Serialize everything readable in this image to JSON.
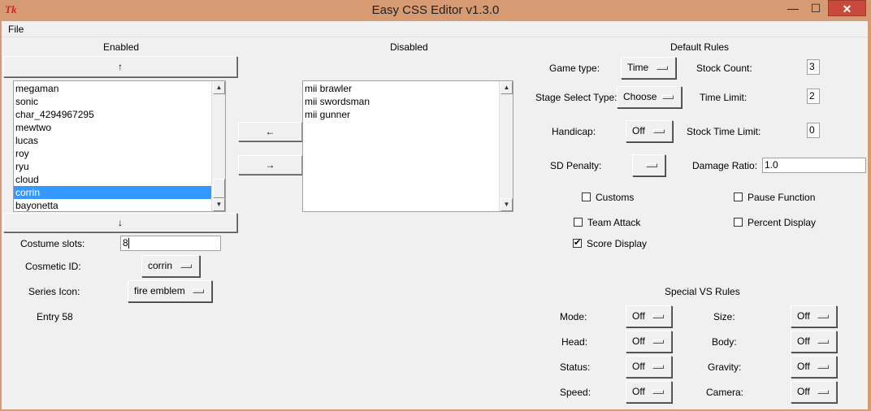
{
  "window": {
    "title": "Easy CSS Editor v1.3.0",
    "icon": "tk-feather-icon"
  },
  "window_controls": {
    "minimize": "—",
    "maximize": "☐",
    "close": "✕"
  },
  "menu": {
    "file": "File"
  },
  "enabled": {
    "header": "Enabled",
    "up_label": "↑",
    "down_label": "↓",
    "items": [
      "megaman",
      "sonic",
      "char_4294967295",
      "mewtwo",
      "lucas",
      "roy",
      "ryu",
      "cloud",
      "corrin",
      "bayonetta"
    ],
    "selected": "corrin"
  },
  "disabled": {
    "header": "Disabled",
    "items": [
      "mii brawler",
      "mii swordsman",
      "mii gunner"
    ]
  },
  "move": {
    "to_enabled": "←",
    "to_disabled": "→"
  },
  "fighter": {
    "costume_slots_label": "Costume slots:",
    "costume_slots_value": "8",
    "cosmetic_id_label": "Cosmetic ID:",
    "cosmetic_id_value": "corrin",
    "series_icon_label": "Series Icon:",
    "series_icon_value": "fire emblem",
    "entry_text": "Entry 58"
  },
  "default_rules": {
    "header": "Default Rules",
    "game_type_label": "Game type:",
    "game_type_value": "Time",
    "stage_select_label": "Stage Select Type:",
    "stage_select_value": "Choose",
    "handicap_label": "Handicap:",
    "handicap_value": "Off",
    "sd_penalty_label": "SD Penalty:",
    "sd_penalty_value": "",
    "stock_count_label": "Stock Count:",
    "stock_count_value": "3",
    "time_limit_label": "Time Limit:",
    "time_limit_value": "2",
    "stock_time_limit_label": "Stock Time Limit:",
    "stock_time_limit_value": "0",
    "damage_ratio_label": "Damage Ratio:",
    "damage_ratio_value": "1.0",
    "checkboxes": {
      "customs": {
        "label": "Customs",
        "checked": false
      },
      "team_attack": {
        "label": "Team Attack",
        "checked": false
      },
      "score_display": {
        "label": "Score Display",
        "checked": true
      },
      "pause_function": {
        "label": "Pause Function",
        "checked": false
      },
      "percent_display": {
        "label": "Percent Display",
        "checked": false
      }
    }
  },
  "special_vs": {
    "header": "Special VS Rules",
    "mode_label": "Mode:",
    "mode_value": "Off",
    "head_label": "Head:",
    "head_value": "Off",
    "status_label": "Status:",
    "status_value": "Off",
    "speed_label": "Speed:",
    "speed_value": "Off",
    "size_label": "Size:",
    "size_value": "Off",
    "body_label": "Body:",
    "body_value": "Off",
    "gravity_label": "Gravity:",
    "gravity_value": "Off",
    "camera_label": "Camera:",
    "camera_value": "Off"
  }
}
